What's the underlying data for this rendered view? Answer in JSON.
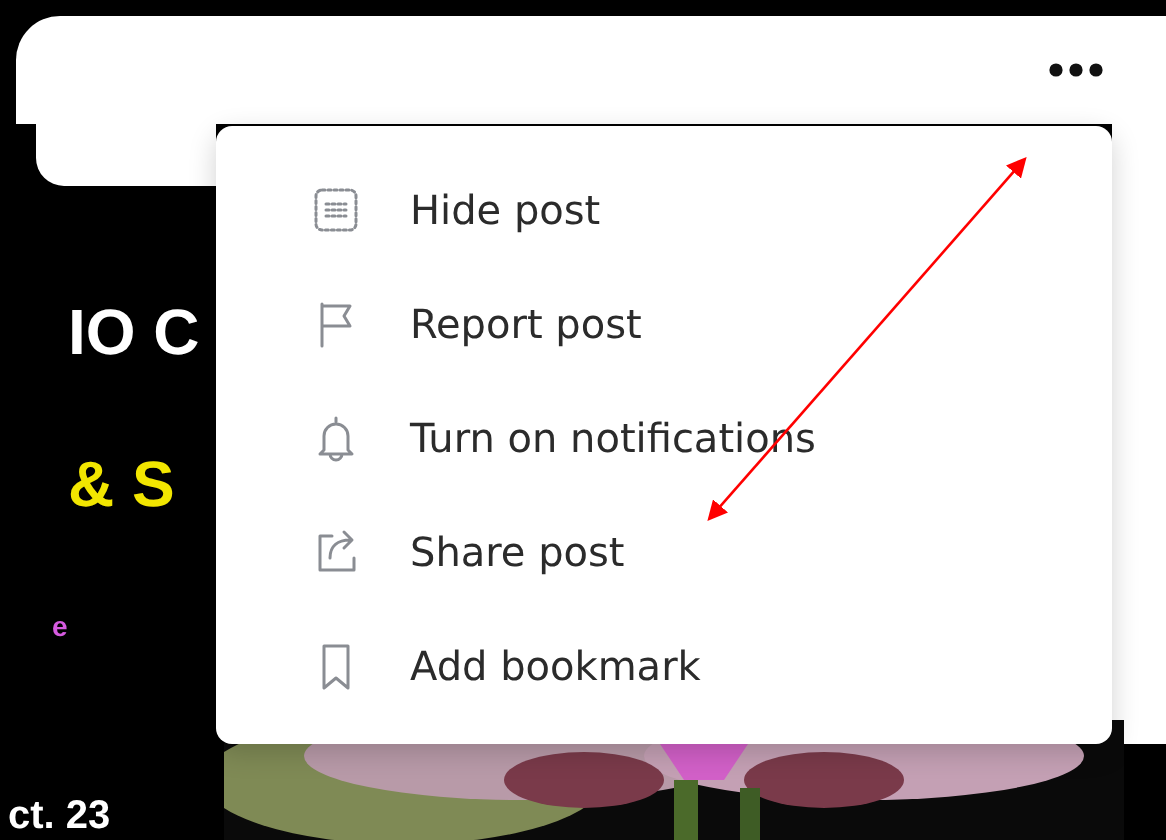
{
  "poster": {
    "lines": [
      {
        "text": "IO C",
        "color": "#ffffff"
      },
      {
        "text": "& S",
        "color": "#f2e600"
      },
      {
        "text": "e",
        "color": "#d65be0"
      },
      {
        "text": "ct. 23",
        "color": "#ffffff"
      }
    ]
  },
  "menu": {
    "items": [
      {
        "kind": "hide",
        "label": "Hide post"
      },
      {
        "kind": "report",
        "label": "Report post"
      },
      {
        "kind": "notify",
        "label": "Turn on notifications"
      },
      {
        "kind": "share",
        "label": "Share post"
      },
      {
        "kind": "bookmark",
        "label": "Add bookmark"
      }
    ]
  }
}
